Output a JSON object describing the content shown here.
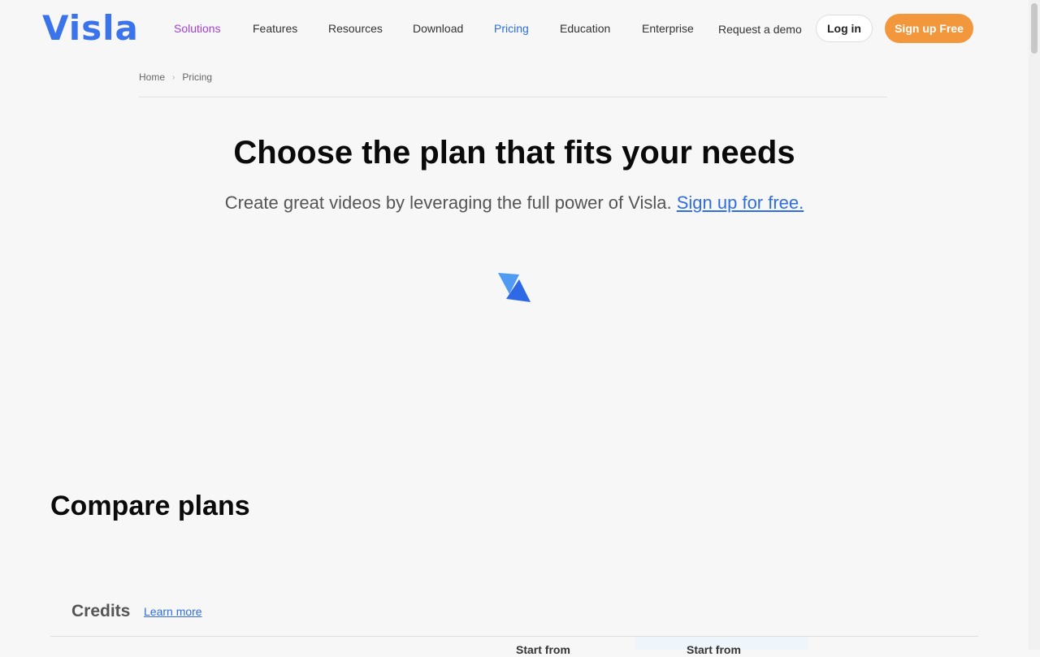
{
  "brand": {
    "logo_text": "Visla",
    "accent": "#3b73ea"
  },
  "nav": {
    "items": [
      {
        "label": "Solutions",
        "color": "#a53fd2"
      },
      {
        "label": "Features"
      },
      {
        "label": "Resources"
      },
      {
        "label": "Download"
      },
      {
        "label": "Pricing",
        "color": "#2f6de0",
        "active": true
      },
      {
        "label": "Education"
      },
      {
        "label": "Enterprise"
      }
    ],
    "request_demo": "Request a demo",
    "login": "Log in",
    "signup": "Sign up Free",
    "signup_color": "#f3973d"
  },
  "breadcrumb": {
    "home": "Home",
    "current": "Pricing",
    "separator_icon": "chevron-right-icon"
  },
  "hero": {
    "title": "Choose the plan that fits your needs",
    "subtitle": "Create great videos by leveraging the full power of Visla. ",
    "link": "Sign up for free."
  },
  "loader": {
    "icon": "visla-spinner-icon"
  },
  "compare": {
    "title": "Compare plans",
    "section_title": "Credits",
    "learn_more": "Learn more",
    "columns": [
      "Start from",
      "Start from"
    ]
  }
}
